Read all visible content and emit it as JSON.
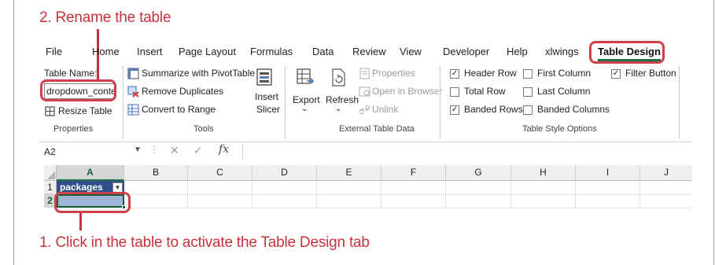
{
  "callouts": {
    "top": "2. Rename the table",
    "bottom": "1. Click in the table to activate the Table Design tab"
  },
  "menu": {
    "tabs": [
      "File",
      "Home",
      "Insert",
      "Page Layout",
      "Formulas",
      "Data",
      "Review",
      "View",
      "Developer",
      "Help",
      "xlwings",
      "Table Design"
    ],
    "active_tab": "Table Design"
  },
  "ribbon": {
    "properties": {
      "table_name_label": "Table Name:",
      "table_name_value": "dropdown_conte",
      "resize_table": "Resize Table",
      "group_label": "Properties"
    },
    "tools": {
      "summarize": "Summarize with PivotTable",
      "remove_duplicates": "Remove Duplicates",
      "convert_to_range": "Convert to Range",
      "insert_slicer_line1": "Insert",
      "insert_slicer_line2": "Slicer",
      "group_label": "Tools"
    },
    "external": {
      "export": "Export",
      "refresh": "Refresh",
      "properties": "Properties",
      "open_in_browser": "Open in Browser",
      "unlink": "Unlink",
      "group_label": "External Table Data"
    },
    "style_options": {
      "header_row": "Header Row",
      "total_row": "Total Row",
      "banded_rows": "Banded Rows",
      "first_column": "First Column",
      "last_column": "Last Column",
      "banded_columns": "Banded Columns",
      "filter_button": "Filter Button",
      "header_row_checked": true,
      "total_row_checked": false,
      "banded_rows_checked": true,
      "first_column_checked": false,
      "last_column_checked": false,
      "banded_columns_checked": false,
      "filter_button_checked": true,
      "group_label": "Table Style Options"
    }
  },
  "formula_bar": {
    "name_box": "A2",
    "fx": "fx",
    "formula": ""
  },
  "sheet": {
    "columns": [
      "A",
      "B",
      "C",
      "D",
      "E",
      "F",
      "G",
      "H",
      "I",
      "J"
    ],
    "rows": [
      "1",
      "2"
    ],
    "header_cell": "packages",
    "selected_cell": "A2"
  },
  "colors": {
    "accent": "#217346",
    "callout": "#c8323c",
    "table_header": "#2f4f8a",
    "table_row": "#9fb4d8"
  }
}
